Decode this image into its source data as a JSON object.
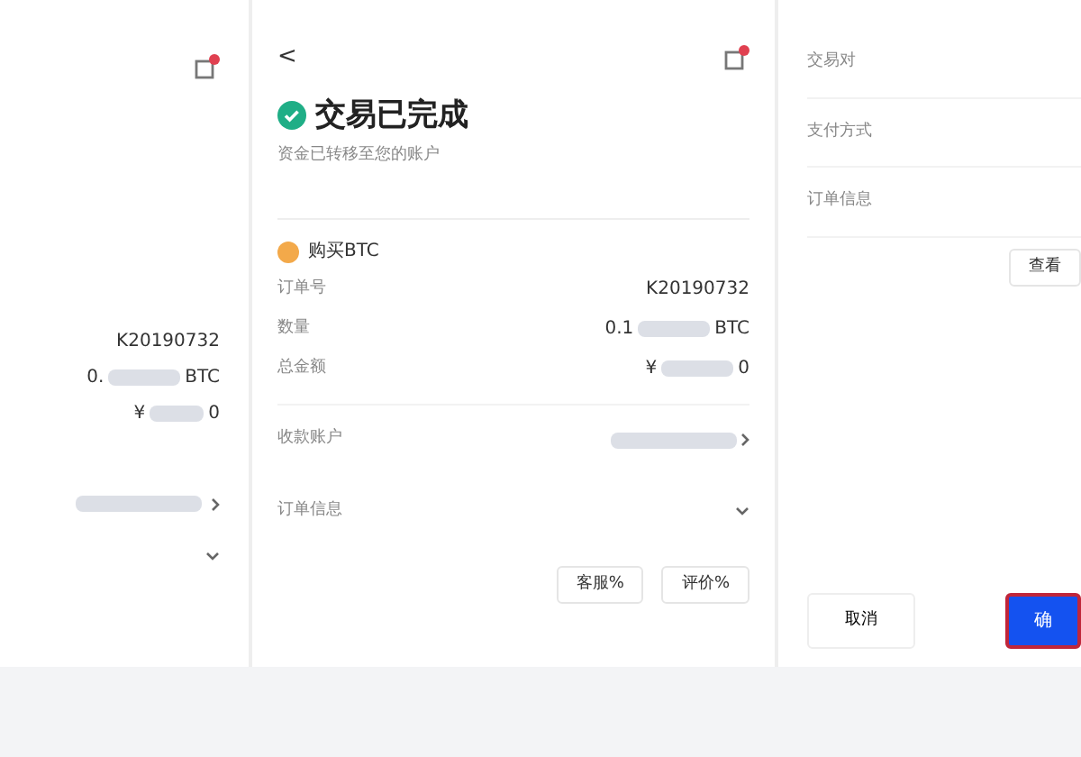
{
  "left_panel": {
    "order_number": "K20190732",
    "amount_prefix": "0.",
    "amount_unit": "BTC",
    "price_prefix": "¥",
    "price_suffix": "0"
  },
  "detail": {
    "back": "<",
    "title": "交易已完成",
    "subtitle": "资金已转移至您的账户",
    "asset": "购买BTC",
    "rows": [
      {
        "label": "订单号",
        "value": "K20190732",
        "kind": "text"
      },
      {
        "label": "数量",
        "value": "0.1",
        "unit": "BTC",
        "kind": "masked"
      },
      {
        "label": "总金额",
        "value": "¥",
        "unit": "0",
        "kind": "masked"
      },
      {
        "label": "收款账户",
        "kind": "link"
      },
      {
        "label": "订单信息",
        "kind": "expand"
      }
    ],
    "buttons": [
      "客服%",
      "评价%"
    ]
  },
  "right_panel": {
    "fields": [
      "交易对",
      "支付方式",
      "订单信息"
    ],
    "view_button": "查看",
    "cancel": "取消",
    "confirm": "确"
  }
}
